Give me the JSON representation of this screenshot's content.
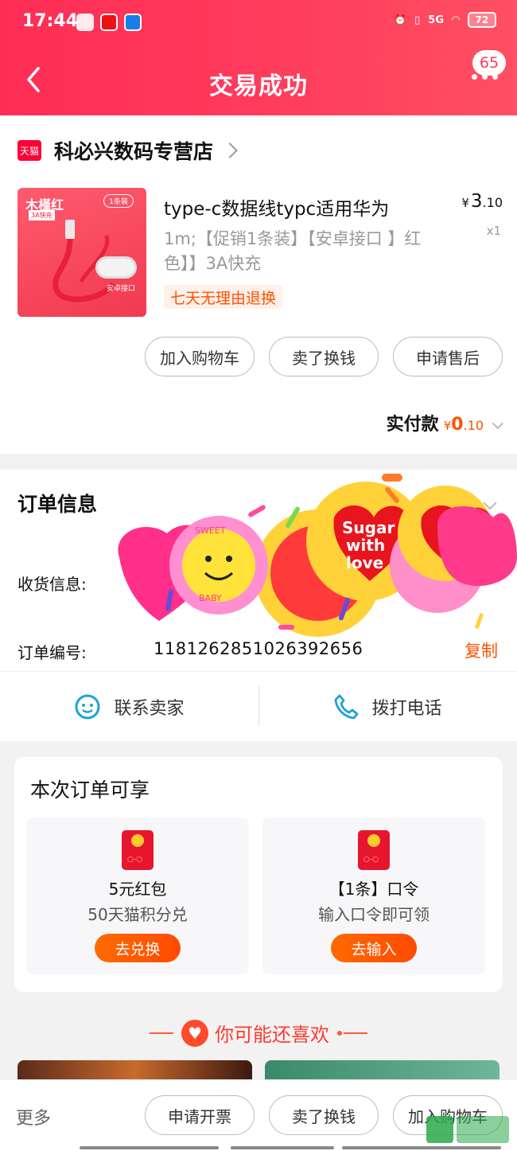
{
  "status_bar": {
    "time": "17:44",
    "network": "5G",
    "battery": "72"
  },
  "header": {
    "title": "交易成功",
    "message_count": "65"
  },
  "shop": {
    "badge": "天猫",
    "name": "科必兴数码专营店"
  },
  "product": {
    "image_brand": "木槿红",
    "image_tag": "3A快充",
    "image_count": "1条装",
    "image_plug_label": "安卓接口",
    "title": "type-c数据线typc适用华为",
    "spec": "1m;【促销1条装】【安卓接口 】红色】】3A快充",
    "price_currency": "¥",
    "price_int": "3",
    "price_dec": ".10",
    "quantity": "x1",
    "return_tag": "七天无理由退换"
  },
  "actions": {
    "add_cart": "加入购物车",
    "resell": "卖了换钱",
    "after_sale": "申请售后"
  },
  "payment": {
    "label": "实付款",
    "currency": "¥",
    "int": "0",
    "dec": ".10"
  },
  "order": {
    "title": "订单信息",
    "shipping_label": "收货信息:",
    "order_no_label": "订单编号:",
    "order_no": "1181262851026392656",
    "copy": "复制"
  },
  "contact": {
    "seller": "联系卖家",
    "phone": "拨打电话"
  },
  "benefits": {
    "title": "本次订单可享",
    "items": [
      {
        "name": "5元红包",
        "desc": "50天猫积分兑",
        "button": "去兑换"
      },
      {
        "name": "【1条】口令",
        "desc": "输入口令即可领",
        "button": "去输入"
      }
    ]
  },
  "recommend": {
    "title": "你可能还喜欢"
  },
  "bottom": {
    "more": "更多",
    "invoice": "申请开票",
    "resell": "卖了换钱",
    "add_cart": "加入购物车"
  },
  "stickers": {
    "text1": "Sugar with love",
    "text2": "SWEET BABY"
  },
  "colors": {
    "brand_red": "#ff2d55",
    "accent_orange": "#ff5000"
  }
}
